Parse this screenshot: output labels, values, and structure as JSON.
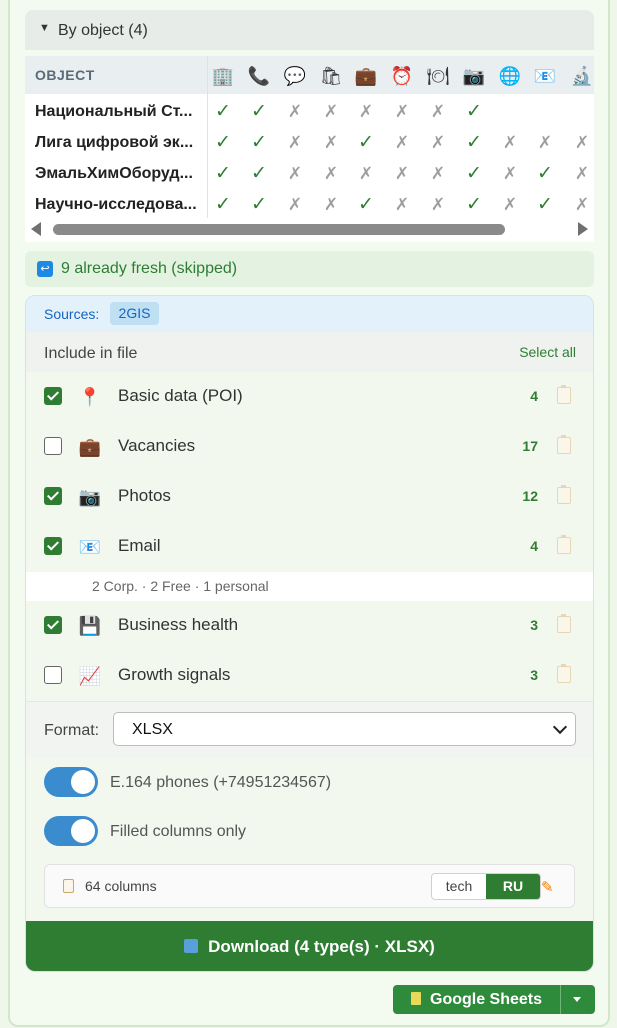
{
  "section": {
    "title": "By object (4)"
  },
  "table": {
    "header_label": "OBJECT",
    "columns": [
      {
        "icon": "building-icon",
        "glyph": "🏢"
      },
      {
        "icon": "phone-icon",
        "glyph": "📞"
      },
      {
        "icon": "speech-bubble-icon",
        "glyph": "💬"
      },
      {
        "icon": "shopping-bags-icon",
        "glyph": "🛍"
      },
      {
        "icon": "briefcase-icon",
        "glyph": "💼"
      },
      {
        "icon": "alarm-clock-icon",
        "glyph": "⏰"
      },
      {
        "icon": "plate-icon",
        "glyph": "🍽"
      },
      {
        "icon": "camera-icon",
        "glyph": "📷"
      },
      {
        "icon": "globe-icon",
        "glyph": "🌐"
      },
      {
        "icon": "email-icon",
        "glyph": "📧"
      },
      {
        "icon": "microscope-icon",
        "glyph": "🔬"
      }
    ],
    "rows": [
      {
        "name": "Национальный Ст...",
        "cells": [
          "✓",
          "✓",
          "✗",
          "✗",
          "✗",
          "✗",
          "✗",
          "✓",
          "",
          "",
          ""
        ]
      },
      {
        "name": "Лига цифровой эк...",
        "cells": [
          "✓",
          "✓",
          "✗",
          "✗",
          "✓",
          "✗",
          "✗",
          "✓",
          "✗",
          "✗",
          "✗"
        ]
      },
      {
        "name": "ЭмальХимОборуд...",
        "cells": [
          "✓",
          "✓",
          "✗",
          "✗",
          "✗",
          "✗",
          "✗",
          "✓",
          "✗",
          "✓",
          "✗"
        ]
      },
      {
        "name": "Научно-исследова...",
        "cells": [
          "✓",
          "✓",
          "✗",
          "✗",
          "✓",
          "✗",
          "✗",
          "✓",
          "✗",
          "✓",
          "✗"
        ]
      }
    ]
  },
  "fresh": {
    "text": "9 already fresh (skipped)"
  },
  "sources": {
    "label": "Sources:",
    "chip": "2GIS"
  },
  "include": {
    "heading": "Include in file",
    "select_all": "Select all",
    "options": [
      {
        "label": "Basic data (POI)",
        "count": "4",
        "checked": true,
        "icon": "pin-icon",
        "glyph": "📍"
      },
      {
        "label": "Vacancies",
        "count": "17",
        "checked": false,
        "icon": "briefcase-icon",
        "glyph": "💼"
      },
      {
        "label": "Photos",
        "count": "12",
        "checked": true,
        "icon": "camera-icon",
        "glyph": "📷"
      },
      {
        "label": "Email",
        "count": "4",
        "checked": true,
        "icon": "email-icon",
        "glyph": "📧"
      },
      {
        "label": "Business health",
        "count": "3",
        "checked": true,
        "icon": "floppy-disk-icon",
        "glyph": "💾"
      },
      {
        "label": "Growth signals",
        "count": "3",
        "checked": false,
        "icon": "chart-increasing-icon",
        "glyph": "📈"
      }
    ],
    "email_sub": "2 Corp. · 2 Free · 1 personal"
  },
  "format": {
    "label": "Format:",
    "value": "XLSX"
  },
  "toggles": [
    {
      "label": "E.164 phones (+74951234567)",
      "on": true
    },
    {
      "label": "Filled columns only",
      "on": true
    }
  ],
  "columns_bar": {
    "text": "64 columns",
    "seg_a": "tech",
    "seg_b": "RU"
  },
  "download": {
    "label": "Download (4 type(s) · XLSX)"
  },
  "google": {
    "label": "Google Sheets"
  }
}
